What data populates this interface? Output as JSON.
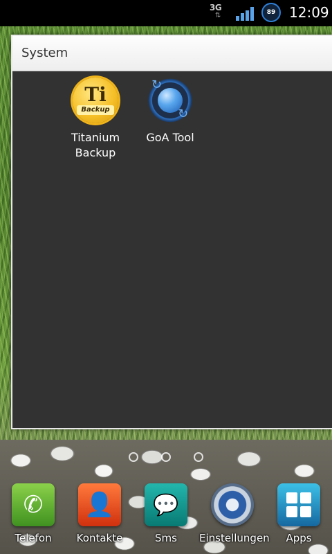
{
  "status_bar": {
    "network_type": "3G",
    "network_arrows": "⇅",
    "signal_icon": "signal-bars-icon",
    "battery_level": "89",
    "time": "12:09"
  },
  "folder": {
    "title": "System",
    "apps": [
      {
        "label": "Titanium Backup",
        "icon": "titanium-backup-icon",
        "badge_main": "Ti",
        "badge_sub": "Backup"
      },
      {
        "label": "GoA Tool",
        "icon": "goa-tool-icon"
      }
    ]
  },
  "dock": {
    "items": [
      {
        "label": "Telefon",
        "icon": "phone-icon",
        "color": "#4fa82a"
      },
      {
        "label": "Kontakte",
        "icon": "contact-icon",
        "color": "#e2441a"
      },
      {
        "label": "Sms",
        "icon": "sms-icon",
        "color": "#0f8a84"
      },
      {
        "label": "Einstellungen",
        "icon": "settings-icon",
        "color": "#3b5f9a"
      },
      {
        "label": "Apps",
        "icon": "apps-grid-icon",
        "color": "#1f7fb0"
      }
    ]
  },
  "colors": {
    "status_bar": "#000000",
    "folder_body": "#323232",
    "folder_header": "#f4f4f4",
    "accent_blue": "#2f7fd6"
  }
}
